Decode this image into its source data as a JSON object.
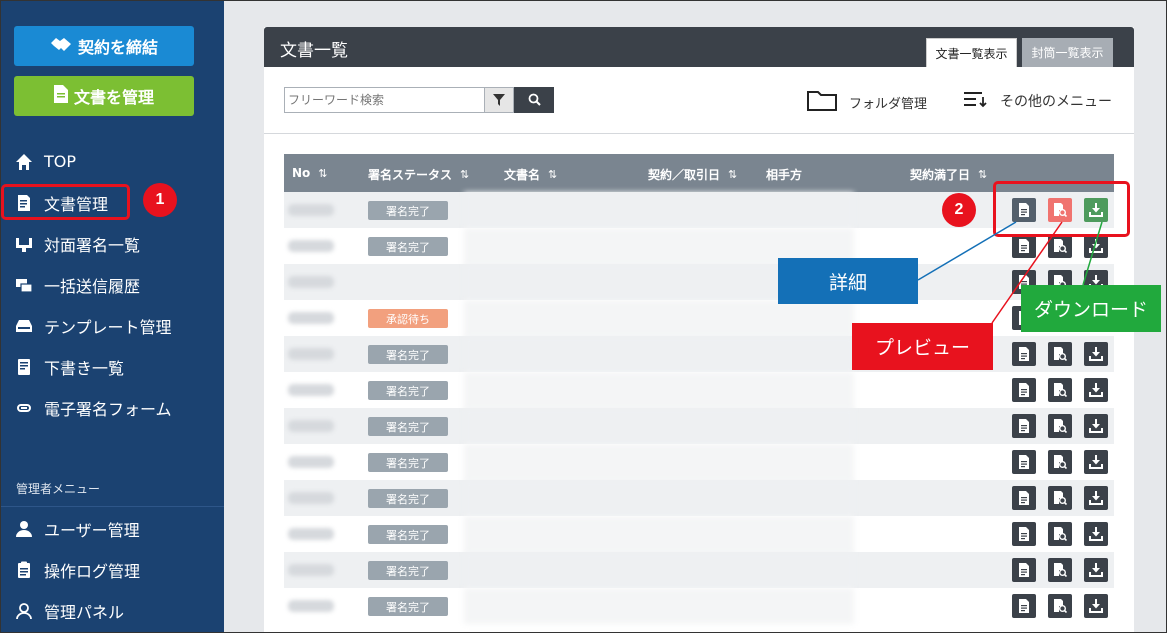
{
  "sidebar": {
    "contract_button": "契約を締結",
    "manage_button": "文書を管理",
    "nav": [
      {
        "label": "TOP",
        "icon": "home-icon"
      },
      {
        "label": "文書管理",
        "icon": "document-icon"
      },
      {
        "label": "対面署名一覧",
        "icon": "face-to-face-icon"
      },
      {
        "label": "一括送信履歴",
        "icon": "bulk-send-icon"
      },
      {
        "label": "テンプレート管理",
        "icon": "template-icon"
      },
      {
        "label": "下書き一覧",
        "icon": "draft-icon"
      },
      {
        "label": "電子署名フォーム",
        "icon": "link-icon"
      }
    ],
    "admin_title": "管理者メニュー",
    "admin_nav": [
      {
        "label": "ユーザー管理",
        "icon": "user-icon"
      },
      {
        "label": "操作ログ管理",
        "icon": "log-icon"
      },
      {
        "label": "管理パネル",
        "icon": "admin-panel-icon"
      }
    ]
  },
  "main": {
    "title": "文書一覧",
    "tabs": [
      "文書一覧表示",
      "封筒一覧表示"
    ],
    "search": {
      "placeholder": "フリーワード検索"
    },
    "folder_link": "フォルダ管理",
    "other_menu": "その他のメニュー",
    "table": {
      "headers": [
        "No",
        "署名ステータス",
        "文書名",
        "契約／取引日",
        "相手方",
        "契約満了日"
      ],
      "rows": [
        {
          "status": "署名完了",
          "type": "done"
        },
        {
          "status": "署名完了",
          "type": "done"
        },
        {
          "status": "",
          "type": "none"
        },
        {
          "status": "承認待ち",
          "type": "wait"
        },
        {
          "status": "署名完了",
          "type": "done"
        },
        {
          "status": "署名完了",
          "type": "done"
        },
        {
          "status": "署名完了",
          "type": "done"
        },
        {
          "status": "署名完了",
          "type": "done"
        },
        {
          "status": "署名完了",
          "type": "done"
        },
        {
          "status": "署名完了",
          "type": "done"
        },
        {
          "status": "署名完了",
          "type": "done"
        },
        {
          "status": "署名完了",
          "type": "done"
        }
      ]
    }
  },
  "annotations": {
    "step1": "1",
    "step2": "2",
    "detail": "詳細",
    "preview": "プレビュー",
    "download": "ダウンロード"
  },
  "colors": {
    "sidebar": "#1b4271",
    "contract_button": "#1a8ad4",
    "manage_button": "#7cbf33",
    "highlight_red": "#e8121e",
    "detail_blue": "#1470b7",
    "download_green": "#21a93d"
  }
}
